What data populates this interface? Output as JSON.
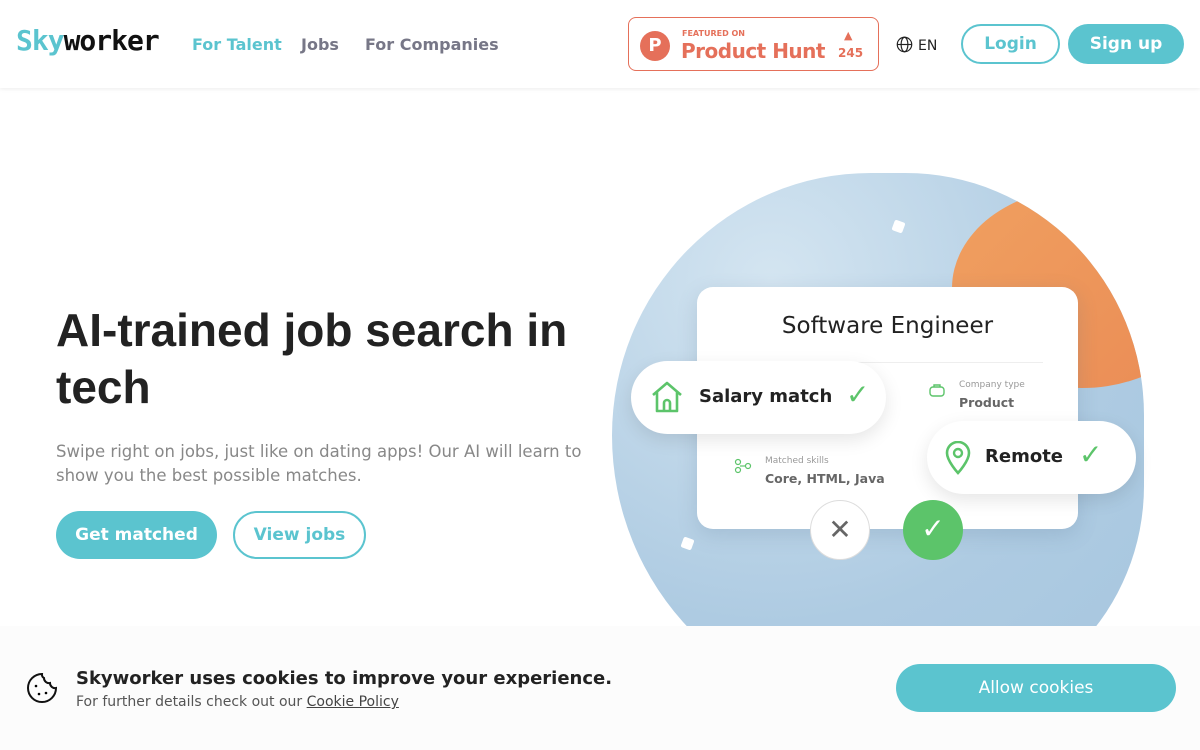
{
  "header": {
    "logo_part1": "Sky",
    "logo_part2": "worker",
    "nav": [
      "For Talent",
      "Jobs",
      "For Companies"
    ],
    "product_hunt": {
      "featured": "FEATURED ON",
      "name": "Product Hunt",
      "count": "245"
    },
    "language": "EN",
    "login": "Login",
    "signup": "Sign up"
  },
  "hero": {
    "title": "AI-trained job search in tech",
    "subtitle": "Swipe right on jobs, just like on dating apps! Our AI will learn to show you the best possible matches.",
    "primary": "Get matched",
    "secondary": "View jobs"
  },
  "illustration": {
    "job_title": "Software Engineer",
    "salary": "Salary match",
    "company_type_label": "Company type",
    "company_type": "Product",
    "skills_label": "Matched skills",
    "skills": "Core, HTML, Java",
    "remote": "Remote"
  },
  "cookie": {
    "heading": "Skyworker uses cookies to improve your experience.",
    "text": "For further details check out our ",
    "link": "Cookie Policy",
    "button": "Allow cookies"
  },
  "colors": {
    "accent": "#5bc4cf",
    "product_hunt": "#e5705a",
    "success": "#5cc46a",
    "orange": "#ea8b55"
  }
}
